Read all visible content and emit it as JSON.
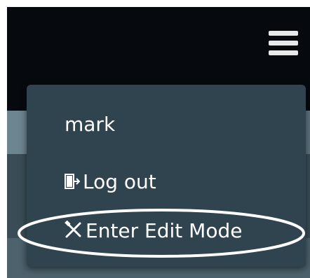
{
  "header": {
    "menu_icon": "hamburger-menu-icon"
  },
  "dropdown": {
    "user_label": "mark",
    "logout_label": "Log out",
    "logout_icon": "logout-door-icon",
    "edit_label": "Enter Edit Mode",
    "edit_icon": "tools-icon"
  },
  "colors": {
    "topbar": "#060a0f",
    "menu_bg": "#30444f",
    "text": "#ffffff",
    "highlight": "#ffffff"
  }
}
